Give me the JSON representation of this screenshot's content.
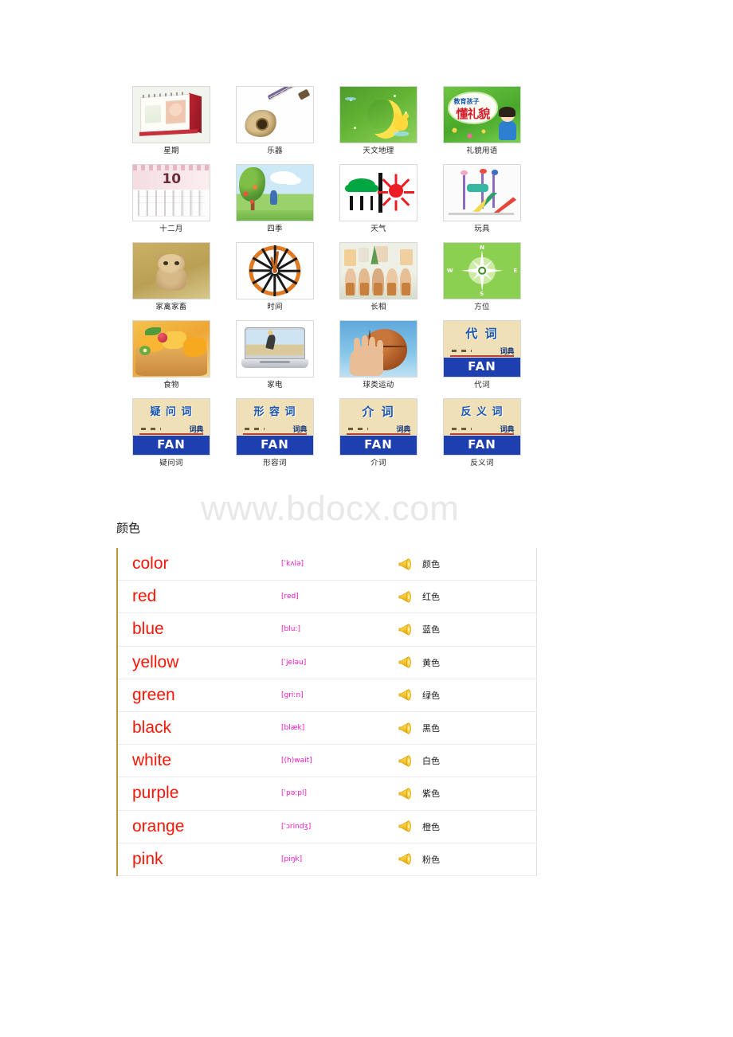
{
  "thumbnails": {
    "rows": [
      [
        {
          "caption": "星期",
          "art": "calendar-desk",
          "icon_name": "desk-calendar-photo"
        },
        {
          "caption": "乐器",
          "art": "guitar",
          "icon_name": "acoustic-guitar-photo"
        },
        {
          "caption": "天文地理",
          "art": "moon",
          "icon_name": "crescent-moon-illustration"
        },
        {
          "caption": "礼貌用语",
          "art": "manners",
          "icon_name": "childrens-book-cover"
        }
      ],
      [
        {
          "caption": "十二月",
          "art": "month",
          "icon_name": "month-calendar-photo"
        },
        {
          "caption": "四季",
          "art": "seasons",
          "icon_name": "four-seasons-illustration"
        },
        {
          "caption": "天气",
          "art": "weather",
          "icon_name": "weather-pictogram"
        },
        {
          "caption": "玩具",
          "art": "toys",
          "icon_name": "playground-toys-photo"
        }
      ],
      [
        {
          "caption": "家禽家畜",
          "art": "kitten",
          "icon_name": "kitten-photo"
        },
        {
          "caption": "时间",
          "art": "clock",
          "icon_name": "wall-clock-illustration"
        },
        {
          "caption": "长相",
          "art": "faces",
          "icon_name": "figurines-photo"
        },
        {
          "caption": "方位",
          "art": "compass",
          "icon_name": "compass-rose-illustration"
        }
      ],
      [
        {
          "caption": "食物",
          "art": "food",
          "icon_name": "fruit-tart-photo"
        },
        {
          "caption": "家电",
          "art": "laptop",
          "icon_name": "laptop-photo"
        },
        {
          "caption": "球类运动",
          "art": "ball",
          "icon_name": "basketball-photo"
        },
        {
          "caption": "代词",
          "art": "dict",
          "icon_name": "dictionary-cover",
          "dict_title": "代 词",
          "dict_sub": "词典",
          "dict_fan": "FAN"
        }
      ],
      [
        {
          "caption": "疑问词",
          "art": "dict",
          "icon_name": "dictionary-cover",
          "dict_title": "疑 问 词",
          "dict_sub": "词典",
          "dict_fan": "FAN"
        },
        {
          "caption": "形容词",
          "art": "dict",
          "icon_name": "dictionary-cover",
          "dict_title": "形 容 词",
          "dict_sub": "词典",
          "dict_fan": "FAN"
        },
        {
          "caption": "介词",
          "art": "dict",
          "icon_name": "dictionary-cover",
          "dict_title": "介 词",
          "dict_sub": "词典",
          "dict_fan": "FAN"
        },
        {
          "caption": "反义词",
          "art": "dict",
          "icon_name": "dictionary-cover",
          "dict_title": "反 义 词",
          "dict_sub": "词典",
          "dict_fan": "FAN"
        }
      ]
    ]
  },
  "watermark": {
    "text": "www.bdocx.com"
  },
  "section": {
    "heading": "颜色"
  },
  "color_table": {
    "audio_icon_name": "speaker-icon",
    "rows": [
      {
        "word": "color",
        "phonetic": "[ˈkʌlə]",
        "chinese": "颜色"
      },
      {
        "word": "red",
        "phonetic": "[red]",
        "chinese": "红色"
      },
      {
        "word": "blue",
        "phonetic": "[bluː]",
        "chinese": "蓝色"
      },
      {
        "word": "yellow",
        "phonetic": "[ˈjeləu]",
        "chinese": "黄色"
      },
      {
        "word": "green",
        "phonetic": "[griːn]",
        "chinese": "绿色"
      },
      {
        "word": "black",
        "phonetic": "[blæk]",
        "chinese": "黑色"
      },
      {
        "word": "white",
        "phonetic": "[(h)wait]",
        "chinese": "白色"
      },
      {
        "word": "purple",
        "phonetic": "[ˈpəːpl]",
        "chinese": "紫色"
      },
      {
        "word": "orange",
        "phonetic": "[ˈɔrindʒ]",
        "chinese": "橙色"
      },
      {
        "word": "pink",
        "phonetic": "[piŋk]",
        "chinese": "粉色"
      }
    ]
  },
  "colors": {
    "word_red": "#fb1708",
    "phonetic_magenta": "#f813c4",
    "table_left_border": "#b39a34",
    "row_divider": "#eaeaea",
    "watermark_gray": "#e8e8e8",
    "speaker_gold": "#f5c22b"
  }
}
